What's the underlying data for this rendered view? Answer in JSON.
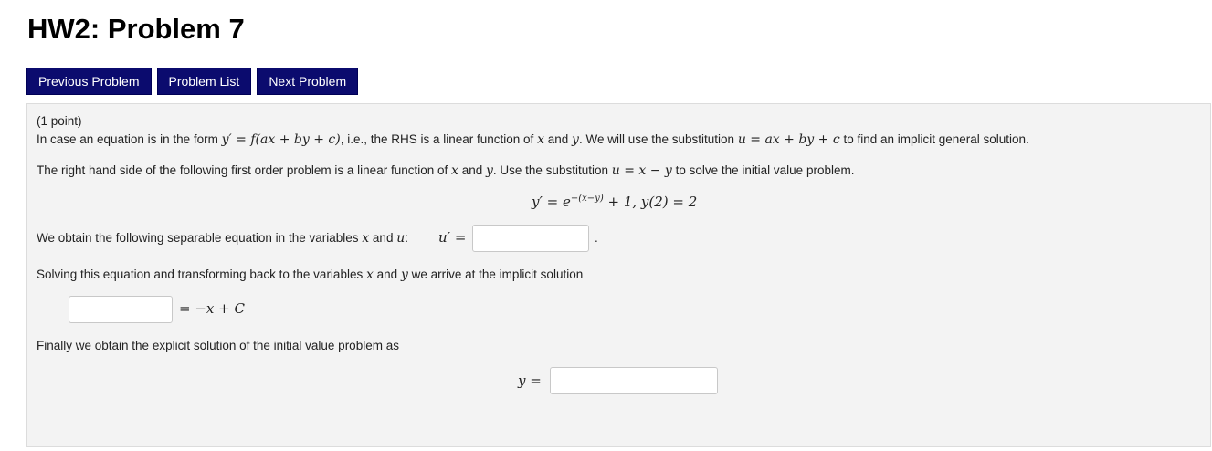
{
  "header": {
    "title": "HW2: Problem 7"
  },
  "nav": {
    "previous": "Previous Problem",
    "list": "Problem List",
    "next": "Next Problem"
  },
  "problem": {
    "points": "(1 point)",
    "intro": {
      "p1": "In case an equation is in the form",
      "m1": "y′ = f(ax + by + c)",
      "p2": ", i.e., the RHS is a linear function of",
      "m2": "x",
      "p3": "and",
      "m3": "y",
      "p4": ". We will use the substitution",
      "m4": "u = ax + by + c",
      "p5": "to find an implicit general solution."
    },
    "task": {
      "p1": "The right hand side of the following first order problem is a linear function of",
      "m1": "x",
      "p2": "and",
      "m2": "y",
      "p3": ". Use the substitution",
      "m3": "u = x − y",
      "p4": "to solve the initial value problem."
    },
    "ode": {
      "lhs": "y′ = e",
      "exp": "−(x−y)",
      "rhs": " + 1,  y(2) = 2"
    },
    "separable": {
      "p1": "We obtain the following separable equation in the variables",
      "m1": "x",
      "p2": "and",
      "m2": "u",
      "p3": ":",
      "lhs": "u′ =",
      "after": "."
    },
    "implicit": {
      "p1": "Solving this equation and transforming back to the variables",
      "m1": "x",
      "p2": "and",
      "m2": "y",
      "p3": "we arrive at the implicit solution",
      "rhs": "= −x + C"
    },
    "explicit": {
      "text": "Finally we obtain the explicit solution of the initial value problem as",
      "lhs": "y ="
    },
    "answers": {
      "separable_value": "",
      "implicit_value": "",
      "explicit_value": ""
    }
  }
}
